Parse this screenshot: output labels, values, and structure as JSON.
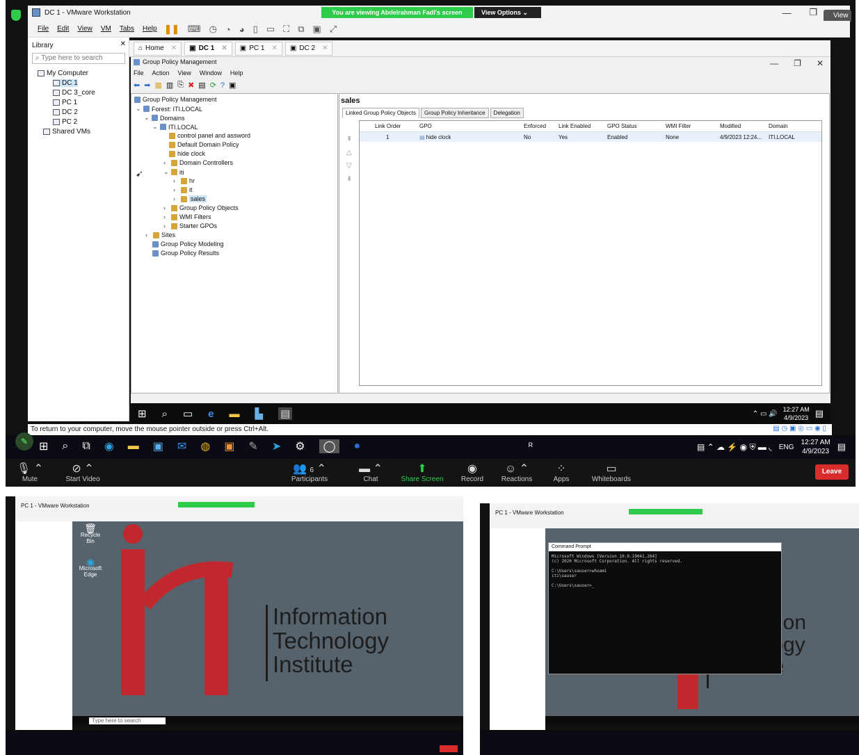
{
  "main": {
    "window_title": "DC 1 - VMware Workstation",
    "banner_text": "You are viewing Abdelrahman Fadl's screen",
    "view_options": "View Options",
    "view_button": "View",
    "menu": [
      "File",
      "Edit",
      "View",
      "VM",
      "Tabs",
      "Help"
    ],
    "library": {
      "title": "Library",
      "search_placeholder": "Type here to search",
      "items": [
        "My Computer",
        "DC 1",
        "DC 3_core",
        "PC 1",
        "DC 2",
        "PC 2",
        "Shared VMs"
      ]
    },
    "tabs": [
      "Home",
      "DC 1",
      "PC 1",
      "DC 2"
    ],
    "gpm": {
      "title": "Group Policy Management",
      "menu": [
        "File",
        "Action",
        "View",
        "Window",
        "Help"
      ],
      "tree": {
        "root": "Group Policy Management",
        "forest": "Forest: ITI.LOCAL",
        "domains": "Domains",
        "domain": "ITI.LOCAL",
        "gpos": [
          "control panel and  assword",
          "Default Domain Policy",
          "hide clock"
        ],
        "domain_controllers": "Domain Controllers",
        "ou_iti": "iti",
        "ou_children": [
          "hr",
          "it",
          "sales"
        ],
        "group_policy_objects": "Group Policy Objects",
        "wmi_filters": "WMI Filters",
        "starter_gpos": "Starter GPOs",
        "sites": "Sites",
        "modeling": "Group Policy Modeling",
        "results": "Group Policy Results"
      },
      "detail": {
        "title": "sales",
        "tabs": [
          "Linked Group Policy Objects",
          "Group Policy Inheritance",
          "Delegation"
        ],
        "columns": [
          "Link Order",
          "GPO",
          "Enforced",
          "Link Enabled",
          "GPO Status",
          "WMI Filter",
          "Modified",
          "Domain"
        ],
        "rows": [
          [
            "1",
            "hide clock",
            "No",
            "Yes",
            "Enabled",
            "None",
            "4/9/2023 12:24...",
            "ITI.LOCAL"
          ]
        ]
      }
    },
    "vm_clock": {
      "time": "12:27 AM",
      "date": "4/9/2023"
    },
    "status_text": "To return to your computer, move the mouse pointer outside or press Ctrl+Alt.",
    "host_clock": {
      "time": "12:27 AM",
      "date": "4/9/2023",
      "lang": "ENG"
    },
    "zoom": {
      "mute": "Mute",
      "start_video": "Start Video",
      "participants": "Participants",
      "participants_count": "6",
      "chat": "Chat",
      "share_screen": "Share Screen",
      "record": "Record",
      "reactions": "Reactions",
      "apps": "Apps",
      "whiteboards": "Whiteboards",
      "leave": "Leave"
    }
  },
  "thumb_left": {
    "window_title": "PC 1 - VMware Workstation",
    "logo_lines": [
      "Information",
      "Technology",
      "Institute"
    ],
    "search_placeholder": "Type here to search",
    "desktop_icons": [
      "Recycle Bin",
      "Microsoft Edge"
    ]
  },
  "thumb_right": {
    "window_title": "PC 1 - VMware Workstation",
    "logo_lines": [
      "ation",
      "ology",
      "Institute"
    ],
    "cmd_title": "Command Prompt",
    "cmd_lines": [
      "Microsoft Windows [Version 10.0.19041.264]",
      "(c) 2020 Microsoft Corporation. All rights reserved.",
      "",
      "C:\\Users\\sauser>whoami",
      "iti\\sauser",
      "",
      "C:\\Users\\sauser>_"
    ]
  },
  "colors": {
    "accent_green": "#2ecc4a",
    "leave_red": "#d92c2c",
    "iti_red": "#c0282d",
    "wall": "#56636c"
  }
}
